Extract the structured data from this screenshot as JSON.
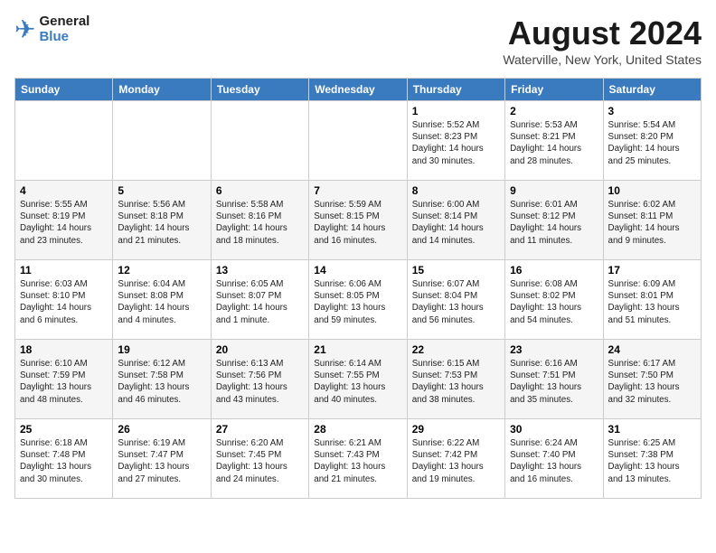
{
  "header": {
    "logo_general": "General",
    "logo_blue": "Blue",
    "month_title": "August 2024",
    "location": "Waterville, New York, United States"
  },
  "days_of_week": [
    "Sunday",
    "Monday",
    "Tuesday",
    "Wednesday",
    "Thursday",
    "Friday",
    "Saturday"
  ],
  "weeks": [
    [
      {
        "day": "",
        "sunrise": "",
        "sunset": "",
        "daylight": ""
      },
      {
        "day": "",
        "sunrise": "",
        "sunset": "",
        "daylight": ""
      },
      {
        "day": "",
        "sunrise": "",
        "sunset": "",
        "daylight": ""
      },
      {
        "day": "",
        "sunrise": "",
        "sunset": "",
        "daylight": ""
      },
      {
        "day": "1",
        "sunrise": "Sunrise: 5:52 AM",
        "sunset": "Sunset: 8:23 PM",
        "daylight": "Daylight: 14 hours and 30 minutes."
      },
      {
        "day": "2",
        "sunrise": "Sunrise: 5:53 AM",
        "sunset": "Sunset: 8:21 PM",
        "daylight": "Daylight: 14 hours and 28 minutes."
      },
      {
        "day": "3",
        "sunrise": "Sunrise: 5:54 AM",
        "sunset": "Sunset: 8:20 PM",
        "daylight": "Daylight: 14 hours and 25 minutes."
      }
    ],
    [
      {
        "day": "4",
        "sunrise": "Sunrise: 5:55 AM",
        "sunset": "Sunset: 8:19 PM",
        "daylight": "Daylight: 14 hours and 23 minutes."
      },
      {
        "day": "5",
        "sunrise": "Sunrise: 5:56 AM",
        "sunset": "Sunset: 8:18 PM",
        "daylight": "Daylight: 14 hours and 21 minutes."
      },
      {
        "day": "6",
        "sunrise": "Sunrise: 5:58 AM",
        "sunset": "Sunset: 8:16 PM",
        "daylight": "Daylight: 14 hours and 18 minutes."
      },
      {
        "day": "7",
        "sunrise": "Sunrise: 5:59 AM",
        "sunset": "Sunset: 8:15 PM",
        "daylight": "Daylight: 14 hours and 16 minutes."
      },
      {
        "day": "8",
        "sunrise": "Sunrise: 6:00 AM",
        "sunset": "Sunset: 8:14 PM",
        "daylight": "Daylight: 14 hours and 14 minutes."
      },
      {
        "day": "9",
        "sunrise": "Sunrise: 6:01 AM",
        "sunset": "Sunset: 8:12 PM",
        "daylight": "Daylight: 14 hours and 11 minutes."
      },
      {
        "day": "10",
        "sunrise": "Sunrise: 6:02 AM",
        "sunset": "Sunset: 8:11 PM",
        "daylight": "Daylight: 14 hours and 9 minutes."
      }
    ],
    [
      {
        "day": "11",
        "sunrise": "Sunrise: 6:03 AM",
        "sunset": "Sunset: 8:10 PM",
        "daylight": "Daylight: 14 hours and 6 minutes."
      },
      {
        "day": "12",
        "sunrise": "Sunrise: 6:04 AM",
        "sunset": "Sunset: 8:08 PM",
        "daylight": "Daylight: 14 hours and 4 minutes."
      },
      {
        "day": "13",
        "sunrise": "Sunrise: 6:05 AM",
        "sunset": "Sunset: 8:07 PM",
        "daylight": "Daylight: 14 hours and 1 minute."
      },
      {
        "day": "14",
        "sunrise": "Sunrise: 6:06 AM",
        "sunset": "Sunset: 8:05 PM",
        "daylight": "Daylight: 13 hours and 59 minutes."
      },
      {
        "day": "15",
        "sunrise": "Sunrise: 6:07 AM",
        "sunset": "Sunset: 8:04 PM",
        "daylight": "Daylight: 13 hours and 56 minutes."
      },
      {
        "day": "16",
        "sunrise": "Sunrise: 6:08 AM",
        "sunset": "Sunset: 8:02 PM",
        "daylight": "Daylight: 13 hours and 54 minutes."
      },
      {
        "day": "17",
        "sunrise": "Sunrise: 6:09 AM",
        "sunset": "Sunset: 8:01 PM",
        "daylight": "Daylight: 13 hours and 51 minutes."
      }
    ],
    [
      {
        "day": "18",
        "sunrise": "Sunrise: 6:10 AM",
        "sunset": "Sunset: 7:59 PM",
        "daylight": "Daylight: 13 hours and 48 minutes."
      },
      {
        "day": "19",
        "sunrise": "Sunrise: 6:12 AM",
        "sunset": "Sunset: 7:58 PM",
        "daylight": "Daylight: 13 hours and 46 minutes."
      },
      {
        "day": "20",
        "sunrise": "Sunrise: 6:13 AM",
        "sunset": "Sunset: 7:56 PM",
        "daylight": "Daylight: 13 hours and 43 minutes."
      },
      {
        "day": "21",
        "sunrise": "Sunrise: 6:14 AM",
        "sunset": "Sunset: 7:55 PM",
        "daylight": "Daylight: 13 hours and 40 minutes."
      },
      {
        "day": "22",
        "sunrise": "Sunrise: 6:15 AM",
        "sunset": "Sunset: 7:53 PM",
        "daylight": "Daylight: 13 hours and 38 minutes."
      },
      {
        "day": "23",
        "sunrise": "Sunrise: 6:16 AM",
        "sunset": "Sunset: 7:51 PM",
        "daylight": "Daylight: 13 hours and 35 minutes."
      },
      {
        "day": "24",
        "sunrise": "Sunrise: 6:17 AM",
        "sunset": "Sunset: 7:50 PM",
        "daylight": "Daylight: 13 hours and 32 minutes."
      }
    ],
    [
      {
        "day": "25",
        "sunrise": "Sunrise: 6:18 AM",
        "sunset": "Sunset: 7:48 PM",
        "daylight": "Daylight: 13 hours and 30 minutes."
      },
      {
        "day": "26",
        "sunrise": "Sunrise: 6:19 AM",
        "sunset": "Sunset: 7:47 PM",
        "daylight": "Daylight: 13 hours and 27 minutes."
      },
      {
        "day": "27",
        "sunrise": "Sunrise: 6:20 AM",
        "sunset": "Sunset: 7:45 PM",
        "daylight": "Daylight: 13 hours and 24 minutes."
      },
      {
        "day": "28",
        "sunrise": "Sunrise: 6:21 AM",
        "sunset": "Sunset: 7:43 PM",
        "daylight": "Daylight: 13 hours and 21 minutes."
      },
      {
        "day": "29",
        "sunrise": "Sunrise: 6:22 AM",
        "sunset": "Sunset: 7:42 PM",
        "daylight": "Daylight: 13 hours and 19 minutes."
      },
      {
        "day": "30",
        "sunrise": "Sunrise: 6:24 AM",
        "sunset": "Sunset: 7:40 PM",
        "daylight": "Daylight: 13 hours and 16 minutes."
      },
      {
        "day": "31",
        "sunrise": "Sunrise: 6:25 AM",
        "sunset": "Sunset: 7:38 PM",
        "daylight": "Daylight: 13 hours and 13 minutes."
      }
    ]
  ]
}
